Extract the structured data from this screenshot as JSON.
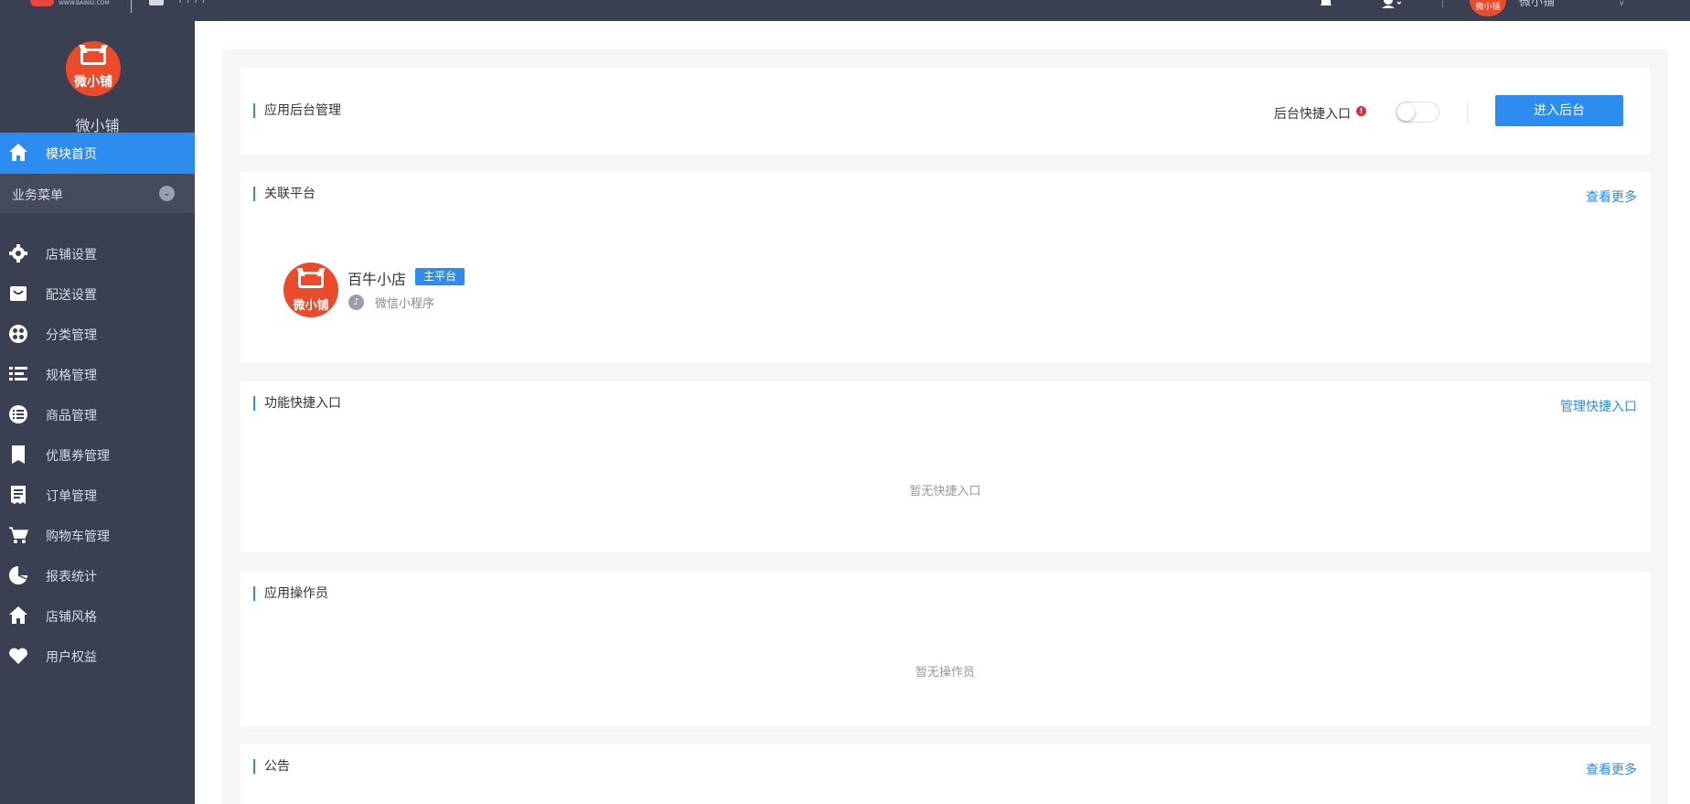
{
  "topbar": {
    "logo_sub": "WWW.BAINIU.COM",
    "crumb": "/ / / /",
    "user_name": "微小铺",
    "avatar_text": "微小铺",
    "caret": "∨"
  },
  "sidebar": {
    "brand_logo_text": "微小铺",
    "brand_name": "微小铺",
    "home": {
      "label": "模块首页",
      "icon": "home-icon"
    },
    "group": {
      "label": "业务菜单",
      "chevron": "⌄"
    },
    "items": [
      {
        "label": "店铺设置",
        "icon": "gear-icon"
      },
      {
        "label": "配送设置",
        "icon": "delivery-icon"
      },
      {
        "label": "分类管理",
        "icon": "category-icon"
      },
      {
        "label": "规格管理",
        "icon": "spec-icon"
      },
      {
        "label": "商品管理",
        "icon": "goods-list-icon"
      },
      {
        "label": "优惠券管理",
        "icon": "coupon-icon"
      },
      {
        "label": "订单管理",
        "icon": "order-icon"
      },
      {
        "label": "购物车管理",
        "icon": "cart-icon"
      },
      {
        "label": "报表统计",
        "icon": "pie-chart-icon"
      },
      {
        "label": "店铺风格",
        "icon": "store-style-icon"
      },
      {
        "label": "用户权益",
        "icon": "heart-icon"
      }
    ]
  },
  "backend_card": {
    "title": "应用后台管理",
    "switch_label": "后台快捷入口",
    "warn_glyph": "!",
    "toggle_on": false,
    "enter_button": "进入后台"
  },
  "platform_card": {
    "title": "关联平台",
    "more_link": "查看更多",
    "shop_logo_text": "微小铺",
    "shop_name": "百牛小店",
    "badge": "主平台",
    "mp_glyph": "♪",
    "mp_type": "微信小程序"
  },
  "shortcut_card": {
    "title": "功能快捷入口",
    "manage_link": "管理快捷入口",
    "empty_text": "暂无快捷入口"
  },
  "operator_card": {
    "title": "应用操作员",
    "empty_text": "暂无操作员"
  },
  "notice_card": {
    "title": "公告",
    "more_link": "查看更多"
  },
  "colors": {
    "sidebar_bg": "#3a3f51",
    "accent": "#2d8cf0",
    "brand_red": "#ea4b2b",
    "page_bg": "#f5f6f8"
  }
}
